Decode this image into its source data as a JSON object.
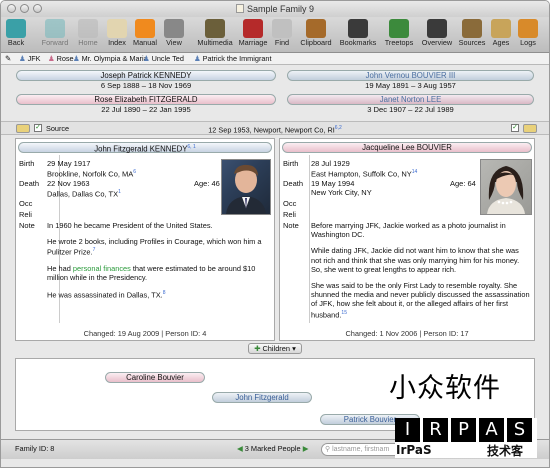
{
  "window": {
    "title": "Sample Family 9"
  },
  "toolbar": [
    {
      "label": "Back",
      "icon": "back-arrow-icon",
      "color": "#3aa0a7"
    },
    {
      "label": "Forward",
      "icon": "forward-arrow-icon",
      "color": "#7ab9bd",
      "disabled": true
    },
    {
      "label": "Home",
      "icon": "home-icon",
      "color": "#b9b9b9",
      "disabled": true
    },
    {
      "label": "Index",
      "icon": "index-icon",
      "color": "#e2d5b0"
    },
    {
      "label": "Manual",
      "icon": "manual-icon",
      "color": "#f08a1e"
    },
    {
      "label": "View",
      "icon": "glasses-icon",
      "color": "#888"
    },
    {
      "label": "Multimedia",
      "icon": "film-icon",
      "color": "#6b5f3a"
    },
    {
      "label": "Marriage",
      "icon": "rose-icon",
      "color": "#b52a2a"
    },
    {
      "label": "Find",
      "icon": "magnifier-icon",
      "color": "#c0c0c0"
    },
    {
      "label": "Clipboard",
      "icon": "clipboard-icon",
      "color": "#a56a2a"
    },
    {
      "label": "Bookmarks",
      "icon": "bookmarks-icon",
      "color": "#3a3a3a"
    },
    {
      "label": "Treetops",
      "icon": "tree-icon",
      "color": "#3c8a3c"
    },
    {
      "label": "Overview",
      "icon": "overview-icon",
      "color": "#3a3a3a"
    },
    {
      "label": "Sources",
      "icon": "shovel-icon",
      "color": "#8a6b3a"
    },
    {
      "label": "Ages",
      "icon": "hourglass-icon",
      "color": "#c8a45a"
    },
    {
      "label": "Logs",
      "icon": "logs-icon",
      "color": "#d88a2a"
    }
  ],
  "bookmarks": [
    "JFK",
    "Rose",
    "Mr. Olympia & Maria",
    "Uncle Ted",
    "Patrick the Immigrant"
  ],
  "parents": {
    "f_father": {
      "name": "Joseph Patrick KENNEDY",
      "dates": "6 Sep 1888 – 18 Nov 1969"
    },
    "f_mother": {
      "name": "Rose Elizabeth FITZGERALD",
      "dates": "22 Jul 1890 – 22 Jan 1995"
    },
    "m_father": {
      "name": "John Vernou BOUVIER III",
      "dates": "19 May 1891 – 3 Aug 1957"
    },
    "m_mother": {
      "name": "Janet Norton LEE",
      "dates": "3 Dec 1907 – 22 Jul 1989"
    }
  },
  "source_bar": {
    "label": "Source",
    "marriage": "12 Sep 1953, Newport, Newport Co, RI",
    "marriage_sup": "6,2"
  },
  "husband": {
    "name": "John Fitzgerald KENNEDY",
    "name_sup": "6, 1",
    "labels": {
      "birth": "Birth",
      "death": "Death",
      "occ": "Occ",
      "reli": "Reli",
      "note": "Note"
    },
    "birth_date": "29 May 1917",
    "birth_place": "Brookline, Norfolk Co, MA",
    "birth_sup": "6",
    "death_date": "22 Nov 1963",
    "death_place": "Dallas, Dallas Co, TX",
    "death_sup": "1",
    "age": "Age: 46",
    "notes": [
      {
        "text": "In 1960 he became President of the United States."
      },
      {
        "text": "He wrote 2 books, including Profiles in Courage, which won him a Pulitzer Prize.",
        "sup": "7"
      },
      {
        "pre": "He had ",
        "link": "personal finances",
        "post": " that were estimated to be around $10 million while in the Presidency."
      },
      {
        "text": "He was assassinated in Dallas, TX.",
        "sup": "8"
      }
    ],
    "footer": "Changed: 19 Aug 2009 | Person ID: 4"
  },
  "wife": {
    "name": "Jacqueline Lee BOUVIER",
    "labels": {
      "birth": "Birth",
      "death": "Death",
      "occ": "Occ",
      "reli": "Reli",
      "note": "Note"
    },
    "birth_date": "28 Jul 1929",
    "birth_place": "East Hampton, Suffolk Co, NY",
    "birth_sup": "14",
    "death_date": "19 May 1994",
    "death_place": "New York City, NY",
    "age": "Age: 64",
    "notes": [
      {
        "text": "Before marrying JFK, Jackie worked as a photo journalist in Washington DC."
      },
      {
        "text": "While dating JFK, Jackie did not want him to know that she was not rich and think that she was only marrying him for his money. So, she went to great lengths to appear rich."
      },
      {
        "text": "She was said to be the only First Lady to resemble royalty. She shunned the media and never publicly discussed the assassination of JFK, how she felt about it, or the alleged affairs of her first husband.",
        "sup": "15"
      }
    ],
    "footer": "Changed: 1 Nov 2006 | Person ID: 17"
  },
  "children": {
    "button": "Children",
    "list": [
      "Caroline Bouvier",
      "John Fitzgerald",
      "Patrick Bouvier"
    ]
  },
  "status": {
    "family_id": "Family ID: 8",
    "marked": "3 Marked People",
    "search_placeholder": "lastname, firstnam"
  },
  "watermark": {
    "cn": "小众软件",
    "brand": "IrPaS",
    "letters": [
      "I",
      "R",
      "P",
      "A",
      "S"
    ],
    "tagline": "技术客"
  }
}
